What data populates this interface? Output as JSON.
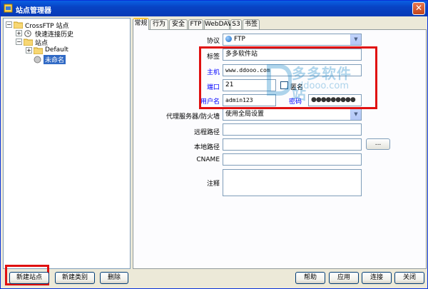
{
  "window": {
    "title": "站点管理器",
    "close_glyph": "✕"
  },
  "tree": {
    "root": "CrossFTP 站点",
    "items": [
      {
        "label": "快速连接历史"
      },
      {
        "label": "站点"
      },
      {
        "label": "Default"
      },
      {
        "label": "未命名",
        "selected": true
      }
    ]
  },
  "tabs": [
    "常规",
    "行为",
    "安全",
    "FTP",
    "WebDAV",
    "S3",
    "书签"
  ],
  "form": {
    "protocol": {
      "label": "协议",
      "value": "FTP"
    },
    "tag": {
      "label": "标签",
      "value": "多多软件站"
    },
    "host": {
      "label": "主机",
      "value": "www.ddooo.com"
    },
    "port": {
      "label": "端口",
      "value": "21"
    },
    "anonymous": {
      "label": "匿名",
      "checked": false
    },
    "username": {
      "label": "用户名",
      "value": "admin123"
    },
    "password": {
      "label": "密码",
      "value": "●●●●●●●●●"
    },
    "proxy": {
      "label": "代理服务器/防火墙",
      "value": "使用全局设置"
    },
    "remote_path": {
      "label": "远程路径",
      "value": ""
    },
    "local_path": {
      "label": "本地路径",
      "value": "",
      "browse_label": "..."
    },
    "cname": {
      "label": "CNAME",
      "value": ""
    },
    "notes": {
      "label": "注释",
      "value": ""
    }
  },
  "watermark": {
    "text": "多多软件站",
    "url": "ddooo.com"
  },
  "buttons": {
    "new_site": "新建站点",
    "new_category": "新建类别",
    "delete": "删除",
    "help": "帮助",
    "apply": "应用",
    "connect": "连接",
    "close": "关闭"
  },
  "colors": {
    "titlebar": "#0843c4",
    "highlight": "#e01010",
    "link_label": "#0000ff",
    "selection": "#316ac5"
  }
}
